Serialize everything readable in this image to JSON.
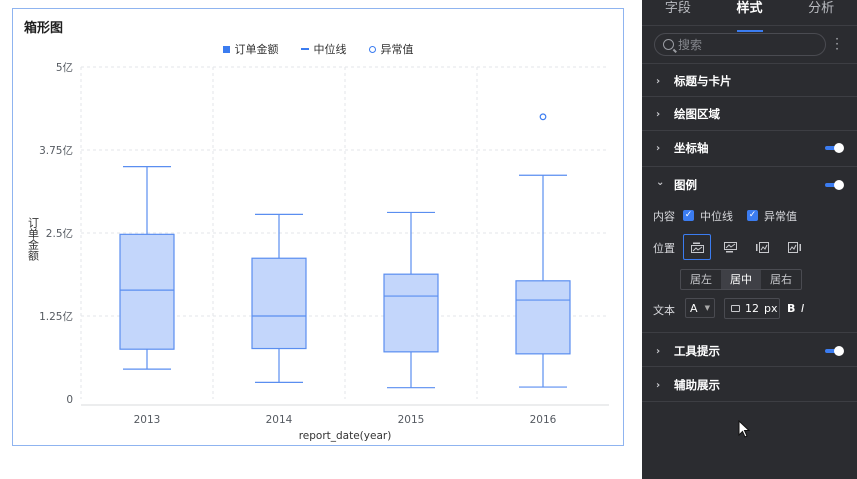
{
  "chart": {
    "title": "箱形图",
    "legend": {
      "box": "订单金额",
      "median": "中位线",
      "outlier": "异常值"
    }
  },
  "chart_data": {
    "type": "box",
    "title": "箱形图",
    "xlabel": "report_date(year)",
    "ylabel": "订单金额",
    "categories": [
      "2013",
      "2014",
      "2015",
      "2016"
    ],
    "y_ticks": [
      "0",
      "1.25亿",
      "2.5亿",
      "3.75亿",
      "5亿"
    ],
    "ylim": [
      0,
      5
    ],
    "unit": "亿",
    "series": [
      {
        "name": "订单金额",
        "stats": [
          {
            "min": 0.45,
            "q1": 0.75,
            "median": 1.64,
            "q3": 2.48,
            "max": 3.5
          },
          {
            "min": 0.25,
            "q1": 0.76,
            "median": 1.25,
            "q3": 2.12,
            "max": 2.78
          },
          {
            "min": 0.17,
            "q1": 0.71,
            "median": 1.55,
            "q3": 1.88,
            "max": 2.81
          },
          {
            "min": 0.18,
            "q1": 0.68,
            "median": 1.49,
            "q3": 1.78,
            "max": 3.37
          }
        ]
      }
    ],
    "outliers": [
      {
        "category": "2016",
        "value": 4.25
      }
    ],
    "legend_position": "top",
    "grid": true,
    "colors": {
      "box_fill": "#c3d6fb",
      "box_stroke": "#5a8ef0",
      "outlier": "#3b7cf0",
      "grid": "#e3e5e8",
      "axis_text": "#555a61"
    }
  },
  "panel": {
    "tabs": [
      "字段",
      "样式",
      "分析"
    ],
    "active_tab": "样式",
    "search_placeholder": "搜索",
    "sections": {
      "title_card": "标题与卡片",
      "plot_area": "绘图区域",
      "axis": "坐标轴",
      "legend": "图例",
      "tooltip": "工具提示",
      "aux": "辅助展示"
    },
    "legend_settings": {
      "content_label": "内容",
      "content_median": "中位线",
      "content_outlier": "异常值",
      "position_label": "位置",
      "align_left": "居左",
      "align_center": "居中",
      "align_right": "居右",
      "text_label": "文本",
      "font_letter": "A",
      "font_size": "12",
      "font_unit": "px",
      "bold": "B",
      "italic": "I"
    },
    "icons": {
      "chevron_right": "›",
      "chevron_down": "⌄"
    }
  }
}
